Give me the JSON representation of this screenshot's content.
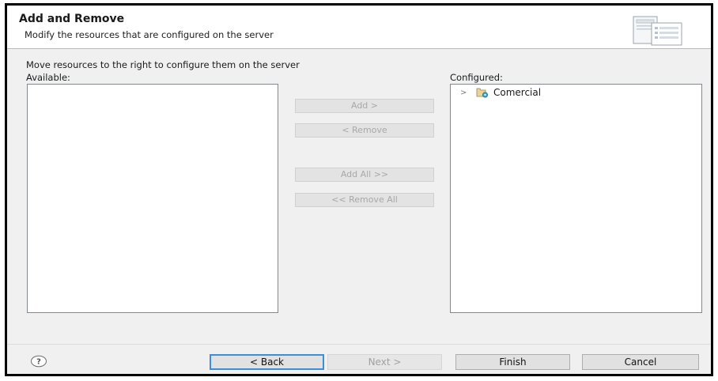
{
  "dialog": {
    "title": "Add and Remove",
    "subtitle": "Modify the resources that are configured on the server",
    "banner_icon": "server-config-icon"
  },
  "main": {
    "instruction": "Move resources to the right to configure them on the server",
    "available_label": "Available:",
    "configured_label": "Configured:",
    "available_items": [],
    "configured_items": [
      {
        "label": "Comercial",
        "icon": "project-icon",
        "expanded": false
      }
    ]
  },
  "actions": {
    "add": "Add >",
    "remove": "< Remove",
    "add_all": "Add All >>",
    "remove_all": "<< Remove All"
  },
  "footer": {
    "help_icon": "help-icon",
    "back": "< Back",
    "next": "Next >",
    "finish": "Finish",
    "cancel": "Cancel"
  }
}
